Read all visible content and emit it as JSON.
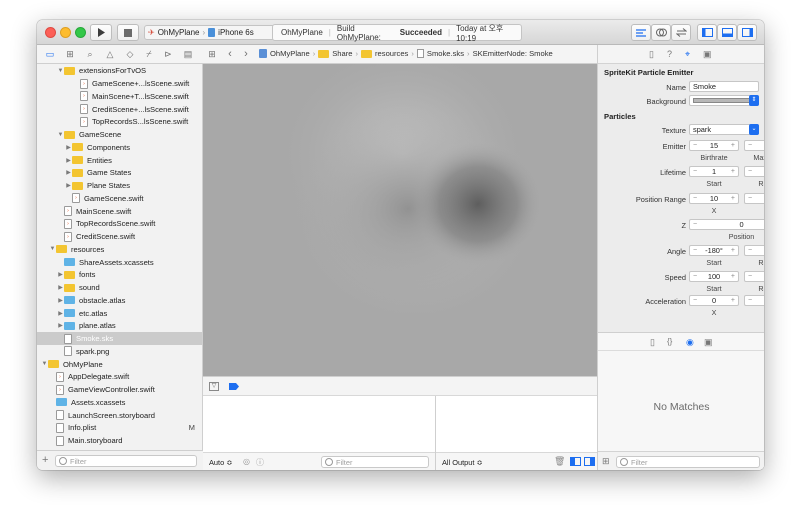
{
  "scheme": {
    "project": "OhMyPlane",
    "device": "iPhone 6s"
  },
  "activity": {
    "project": "OhMyPlane",
    "build_prefix": "Build OhMyPlane:",
    "build_status": "Succeeded",
    "time": "Today at 오후 10:19"
  },
  "breadcrumb": [
    "OhMyPlane",
    "Share",
    "resources",
    "Smoke.sks",
    "SKEmitterNode: Smoke"
  ],
  "navigator": {
    "rows": [
      {
        "label": "extensionsForTvOS",
        "indent": 2,
        "kind": "folder",
        "tri": "▼"
      },
      {
        "label": "GameScene+...lsScene.swift",
        "indent": 4,
        "kind": "swift"
      },
      {
        "label": "MainScene+T...lsScene.swift",
        "indent": 4,
        "kind": "swift"
      },
      {
        "label": "CreditScene+...lsScene.swift",
        "indent": 4,
        "kind": "swift"
      },
      {
        "label": "TopRecordsS...lsScene.swift",
        "indent": 4,
        "kind": "swift"
      },
      {
        "label": "GameScene",
        "indent": 2,
        "kind": "folder",
        "tri": "▼"
      },
      {
        "label": "Components",
        "indent": 3,
        "kind": "folder",
        "tri": "▶"
      },
      {
        "label": "Entities",
        "indent": 3,
        "kind": "folder",
        "tri": "▶"
      },
      {
        "label": "Game States",
        "indent": 3,
        "kind": "folder",
        "tri": "▶"
      },
      {
        "label": "Plane States",
        "indent": 3,
        "kind": "folder",
        "tri": "▶"
      },
      {
        "label": "GameScene.swift",
        "indent": 3,
        "kind": "swift"
      },
      {
        "label": "MainScene.swift",
        "indent": 2,
        "kind": "swift"
      },
      {
        "label": "TopRecordsScene.swift",
        "indent": 2,
        "kind": "swift"
      },
      {
        "label": "CreditScene.swift",
        "indent": 2,
        "kind": "swift"
      },
      {
        "label": "resources",
        "indent": 1,
        "kind": "folder",
        "tri": "▼"
      },
      {
        "label": "ShareAssets.xcassets",
        "indent": 2,
        "kind": "blue"
      },
      {
        "label": "fonts",
        "indent": 2,
        "kind": "folder",
        "tri": "▶"
      },
      {
        "label": "sound",
        "indent": 2,
        "kind": "folder",
        "tri": "▶"
      },
      {
        "label": "obstacle.atlas",
        "indent": 2,
        "kind": "blue",
        "tri": "▶"
      },
      {
        "label": "etc.atlas",
        "indent": 2,
        "kind": "blue",
        "tri": "▶"
      },
      {
        "label": "plane.atlas",
        "indent": 2,
        "kind": "blue",
        "tri": "▶"
      },
      {
        "label": "Smoke.sks",
        "indent": 2,
        "kind": "file",
        "selected": true
      },
      {
        "label": "spark.png",
        "indent": 2,
        "kind": "file"
      },
      {
        "label": "OhMyPlane",
        "indent": 0,
        "kind": "folder",
        "tri": "▼"
      },
      {
        "label": "AppDelegate.swift",
        "indent": 1,
        "kind": "swift"
      },
      {
        "label": "GameViewController.swift",
        "indent": 1,
        "kind": "swift"
      },
      {
        "label": "Assets.xcassets",
        "indent": 1,
        "kind": "blue"
      },
      {
        "label": "LaunchScreen.storyboard",
        "indent": 1,
        "kind": "file"
      },
      {
        "label": "Info.plist",
        "indent": 1,
        "kind": "file",
        "badge": "M"
      },
      {
        "label": "Main.storyboard",
        "indent": 1,
        "kind": "file"
      }
    ],
    "filter_placeholder": "Filter"
  },
  "debug": {
    "auto_label": "Auto ≎",
    "filter_placeholder": "Filter",
    "output_label": "All Output ≎"
  },
  "inspector": {
    "section_title": "SpriteKit Particle Emitter",
    "name_label": "Name",
    "name_value": "Smoke",
    "background_label": "Background",
    "particles_title": "Particles",
    "texture_label": "Texture",
    "texture_value": "spark",
    "emitter_label": "Emitter",
    "birthrate": "15",
    "maximum": "0",
    "birthrate_label": "Birthrate",
    "maximum_label": "Maximum",
    "lifetime_label": "Lifetime",
    "lifetime_start": "1",
    "lifetime_range": "5",
    "position_range_label": "Position Range",
    "pos_range_x": "10",
    "pos_range_y": "10",
    "z_label": "Z",
    "z_value": "0",
    "position_sub": "Position",
    "angle_label": "Angle",
    "angle_start": "-180°",
    "angle_range": "0°",
    "speed_label": "Speed",
    "speed_start": "100",
    "speed_range": "40",
    "acceleration_label": "Acceleration",
    "accel_x": "0",
    "accel_y": "10",
    "start_label": "Start",
    "range_label": "Range",
    "x_label": "X",
    "y_label": "Y",
    "no_matches": "No Matches",
    "filter_placeholder": "Filter"
  },
  "colors": {
    "accent": "#1d6ef0",
    "folder": "#f3c531",
    "blue_folder": "#5fb3e6",
    "editor_bg": "#a8a8a8"
  }
}
